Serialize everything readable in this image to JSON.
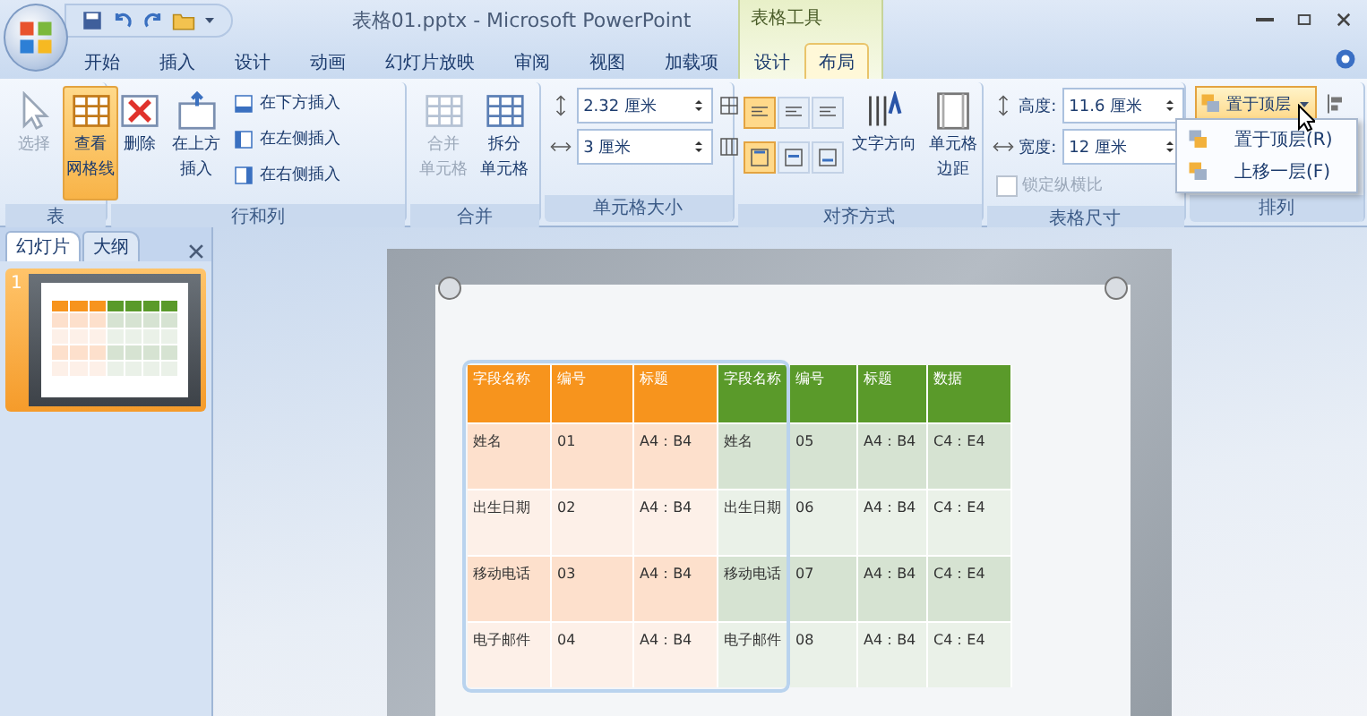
{
  "window": {
    "title": "表格01.pptx - Microsoft PowerPoint"
  },
  "tabs": [
    {
      "label": "开始",
      "selected": false
    },
    {
      "label": "插入",
      "selected": false
    },
    {
      "label": "设计",
      "selected": false
    },
    {
      "label": "动画",
      "selected": false
    },
    {
      "label": "幻灯片放映",
      "selected": false
    },
    {
      "label": "审阅",
      "selected": false
    },
    {
      "label": "视图",
      "selected": false
    },
    {
      "label": "加载项",
      "selected": false
    }
  ],
  "contextual": {
    "title": "表格工具",
    "tabs": [
      {
        "label": "设计",
        "selected": false
      },
      {
        "label": "布局",
        "selected": true
      }
    ]
  },
  "ribbon": {
    "table_group": {
      "label": "表",
      "buttons": [
        {
          "label": [
            "选择"
          ],
          "disabled": true,
          "selected": false
        },
        {
          "label": [
            "查看",
            "网格线"
          ],
          "disabled": false,
          "selected": true
        }
      ]
    },
    "rows_cols": {
      "label": "行和列",
      "delete": "删除",
      "insert_above": [
        "在上方",
        "插入"
      ],
      "inserts": [
        "在下方插入",
        "在左侧插入",
        "在右侧插入"
      ]
    },
    "merge": {
      "label": "合并",
      "buttons": [
        {
          "label": [
            "合并",
            "单元格"
          ],
          "disabled": true
        },
        {
          "label": [
            "拆分",
            "单元格"
          ],
          "disabled": false
        }
      ]
    },
    "cell_size": {
      "label": "单元格大小",
      "height": "2.32 厘米",
      "width": "3 厘米"
    },
    "alignment": {
      "label": "对齐方式",
      "horizontal": [
        {
          "selected": true
        },
        {
          "selected": false
        },
        {
          "selected": false
        }
      ],
      "vertical": [
        {
          "selected": true
        },
        {
          "selected": false
        },
        {
          "selected": false
        }
      ],
      "text_direction": "文字方向",
      "margins": [
        "单元格",
        "边距"
      ]
    },
    "table_size": {
      "label": "表格尺寸",
      "height_label": "高度:",
      "height": "11.6 厘米",
      "width_label": "宽度:",
      "width": "12 厘米",
      "lock": {
        "label": "锁定纵横比",
        "checked": false,
        "disabled": true
      }
    },
    "arrange": {
      "label": "排列",
      "bring_front": "置于顶层",
      "menu": [
        {
          "label": "置于顶层(R)"
        },
        {
          "label": "上移一层(F)"
        }
      ]
    }
  },
  "pane": {
    "tabs": [
      {
        "label": "幻灯片",
        "selected": true
      },
      {
        "label": "大纲",
        "selected": false
      }
    ],
    "slides": [
      {
        "number": "1",
        "selected": true
      }
    ]
  },
  "table": {
    "columns": [
      {
        "label": "字段名称",
        "color": "#f7941d"
      },
      {
        "label": "编号",
        "color": "#f7941d"
      },
      {
        "label": "标题",
        "color": "#f7941d"
      },
      {
        "label": "字段名称",
        "color": "#5a9a2a"
      },
      {
        "label": "编号",
        "color": "#5a9a2a"
      },
      {
        "label": "标题",
        "color": "#5a9a2a"
      },
      {
        "label": "数据",
        "color": "#5a9a2a"
      }
    ],
    "rows": [
      [
        "姓名",
        "01",
        "A4：B4",
        "姓名",
        "05",
        "A4：B4",
        "C4：E4"
      ],
      [
        "出生日期",
        "02",
        "A4：B4",
        "出生日期",
        "06",
        "A4：B4",
        "C4：E4"
      ],
      [
        "移动电话",
        "03",
        "A4：B4",
        "移动电话",
        "07",
        "A4：B4",
        "C4：E4"
      ],
      [
        "电子邮件",
        "04",
        "A4：B4",
        "电子邮件",
        "08",
        "A4：B4",
        "C4：E4"
      ]
    ]
  }
}
